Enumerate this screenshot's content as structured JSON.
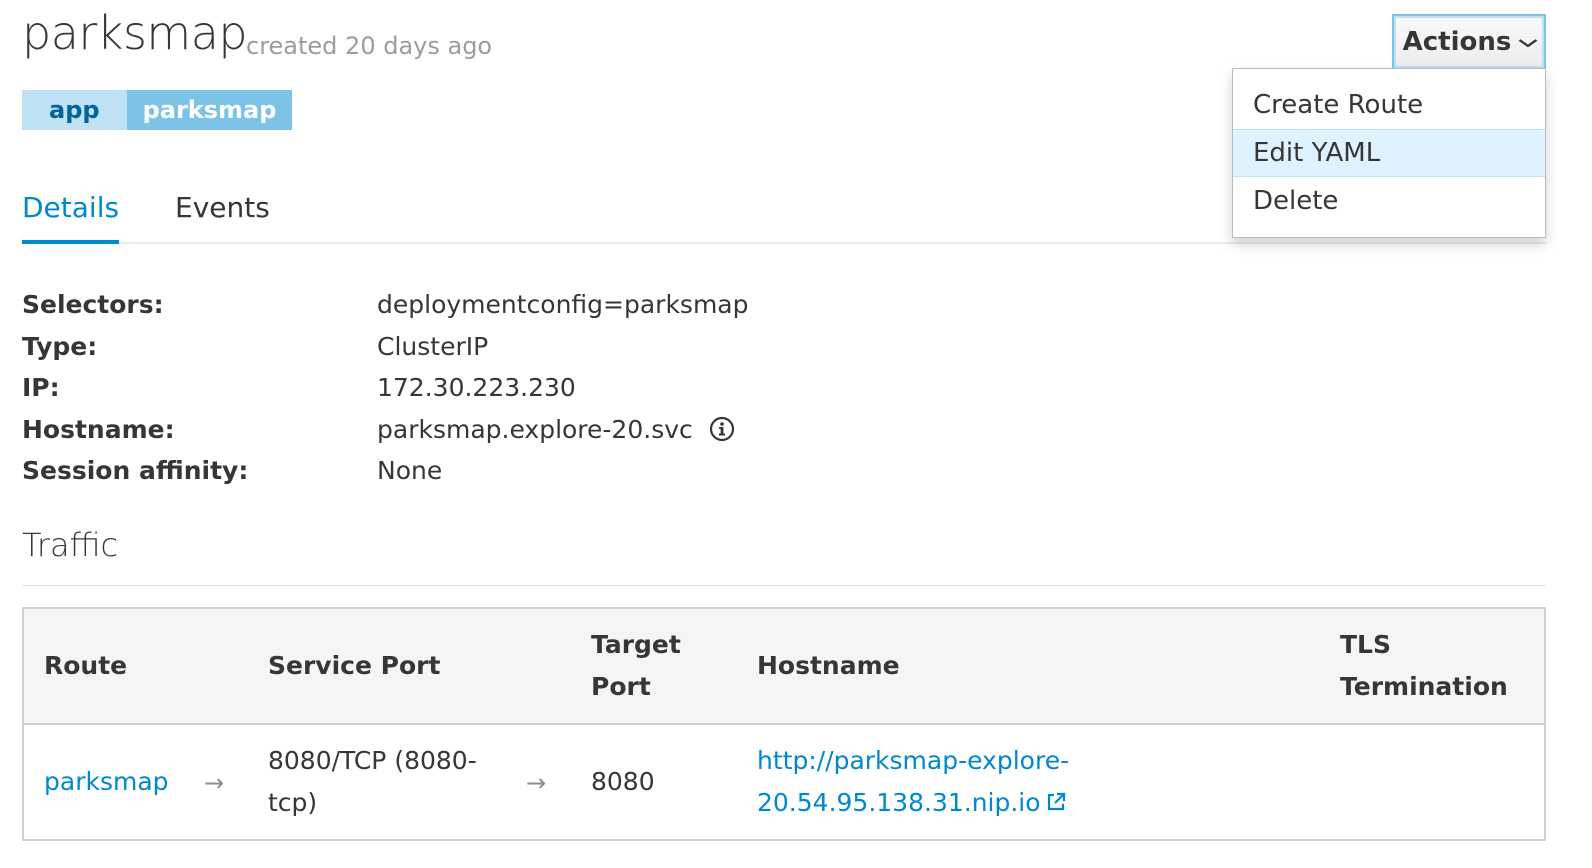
{
  "header": {
    "title": "parksmap",
    "created": "created 20 days ago",
    "labels": [
      {
        "key": "app",
        "value": "parksmap"
      }
    ]
  },
  "tabs": [
    {
      "label": "Details",
      "active": true
    },
    {
      "label": "Events",
      "active": false
    }
  ],
  "actions": {
    "label": "Actions",
    "icon": "chevron-down-icon",
    "menu": [
      {
        "label": "Create Route"
      },
      {
        "label": "Edit YAML",
        "highlighted": true
      },
      {
        "label": "Delete"
      }
    ]
  },
  "details": {
    "selectors": {
      "label": "Selectors:",
      "value": "deploymentconfig=parksmap"
    },
    "type": {
      "label": "Type:",
      "value": "ClusterIP"
    },
    "ip": {
      "label": "IP:",
      "value": "172.30.223.230"
    },
    "hostname": {
      "label": "Hostname:",
      "value": "parksmap.explore-20.svc",
      "icon": "info-icon"
    },
    "session_affinity": {
      "label": "Session affinity:",
      "value": "None"
    }
  },
  "traffic": {
    "title": "Traffic",
    "columns": {
      "route": "Route",
      "service_port": "Service Port",
      "target_port_1": "Target",
      "target_port_2": "Port",
      "hostname": "Hostname",
      "tls_1": "TLS",
      "tls_2": "Termination"
    },
    "rows": [
      {
        "route": "parksmap",
        "arrow": "→",
        "service_port_1": "8080/TCP (8080-",
        "service_port_2": "tcp)",
        "target_port": "8080",
        "hostname_1": "http://parksmap-explore-",
        "hostname_2": "20.54.95.138.31.nip.io",
        "hostname_icon": "external-link-icon",
        "tls": ""
      }
    ]
  },
  "colors": {
    "accent": "#0088ce",
    "label_key_bg": "#bee1f4",
    "label_value_bg": "#7dc3e8",
    "menu_highlight": "#def3ff"
  }
}
